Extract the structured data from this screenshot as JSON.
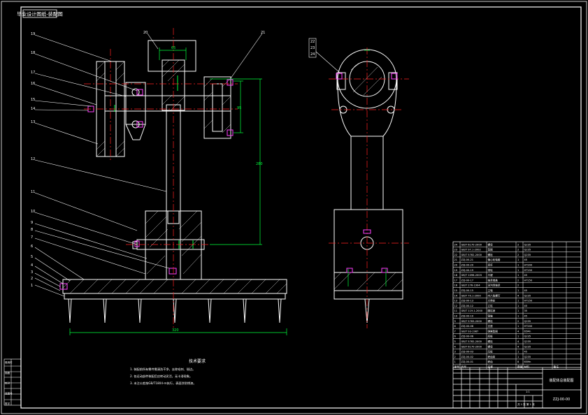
{
  "drawing": {
    "title_tag": "毕业设计图纸-装配图",
    "sheet_title": "装配体总装配图",
    "drawing_number": "ZZJ-00-00",
    "scale": "1:1",
    "sheet_of": "共 1 张 第 1 张"
  },
  "balloons": {
    "left": [
      "19",
      "18",
      "17",
      "16",
      "15",
      "14",
      "13",
      "12",
      "11",
      "10",
      "9",
      "8",
      "7",
      "6",
      "5",
      "4",
      "3",
      "2",
      "1"
    ],
    "top": [
      "20",
      "21"
    ],
    "right_view": [
      "22",
      "23",
      "24"
    ]
  },
  "dimensions": {
    "d1": "65",
    "d2": "45",
    "d3": "95",
    "d4": "280",
    "d5": "35",
    "d6": "18",
    "overall": "320"
  },
  "notes": {
    "heading": "技术要求",
    "lines": [
      "1. 装配前所有零件需清洗干净，去除毛刺、锐边。",
      "2. 各运动部件装配后应转动灵活，无卡滞现象。",
      "3. 未注公差按GB/T1804-m执行，表面涂防锈漆。"
    ]
  },
  "bom": {
    "rows": [
      [
        "24",
        "GB/T 6170-2000",
        "螺母",
        "2",
        "Q235",
        ""
      ],
      [
        "23",
        "GB/T 97.1-2002",
        "垫圈",
        "2",
        "Q235",
        ""
      ],
      [
        "22",
        "GB/T 5782-2000",
        "螺栓",
        "2",
        "Q235",
        ""
      ],
      [
        "21",
        "ZZJ-00-21",
        "偏心轮轴套",
        "1",
        "45",
        ""
      ],
      [
        "20",
        "ZZJ-00-20",
        "连杆",
        "1",
        "HT200",
        ""
      ],
      [
        "19",
        "ZZJ-00-19",
        "带轮",
        "1",
        "HT150",
        ""
      ],
      [
        "18",
        "GB/T 1096-2003",
        "平键",
        "1",
        "45",
        ""
      ],
      [
        "17",
        "ZZJ-00-17",
        "轴承端盖",
        "2",
        "HT150",
        ""
      ],
      [
        "16",
        "GB/T 276-1994",
        "深沟球轴承",
        "2",
        "",
        ""
      ],
      [
        "15",
        "ZZJ-00-15",
        "主轴",
        "1",
        "45",
        ""
      ],
      [
        "14",
        "GB/T 70.1-2000",
        "内六角螺钉",
        "4",
        "Q235",
        ""
      ],
      [
        "13",
        "ZZJ-00-13",
        "大带轮",
        "1",
        "HT150",
        ""
      ],
      [
        "12",
        "ZZJ-00-12",
        "立柱",
        "1",
        "45",
        ""
      ],
      [
        "11",
        "GB/T 119.1-2000",
        "圆柱销",
        "1",
        "35",
        ""
      ],
      [
        "10",
        "ZZJ-00-10",
        "销轴",
        "1",
        "45",
        ""
      ],
      [
        "9",
        "GB/T 5783-2000",
        "螺栓",
        "2",
        "Q235",
        ""
      ],
      [
        "8",
        "ZZJ-00-08",
        "支座",
        "1",
        "HT200",
        ""
      ],
      [
        "7",
        "GB/T 93-1987",
        "弹簧垫圈",
        "4",
        "65Mn",
        ""
      ],
      [
        "6",
        "ZZJ-00-06",
        "底板",
        "1",
        "Q235",
        ""
      ],
      [
        "5",
        "GB/T 5782-2000",
        "螺栓",
        "4",
        "Q235",
        ""
      ],
      [
        "4",
        "GB/T 6170-2000",
        "螺母",
        "4",
        "Q235",
        ""
      ],
      [
        "3",
        "ZZJ-00-03",
        "压板",
        "1",
        "45",
        ""
      ],
      [
        "2",
        "ZZJ-00-02",
        "耙齿架",
        "1",
        "Q235",
        ""
      ],
      [
        "1",
        "ZZJ-00-01",
        "耙齿",
        "8",
        "65Mn",
        ""
      ]
    ],
    "headers": [
      "序号",
      "代号",
      "名称",
      "数量",
      "材料",
      "备注"
    ]
  },
  "left_strip": [
    "借用件",
    "",
    "描图",
    "",
    "校对",
    "",
    "底图号",
    "",
    "签字"
  ],
  "colors": {
    "frame": "#ffffff",
    "part": "#ffffff",
    "center": "#ff2020",
    "dim": "#00ff3c",
    "hatch": "#ffffff",
    "fastener": "#ff40ff",
    "text": "#ffffff"
  }
}
